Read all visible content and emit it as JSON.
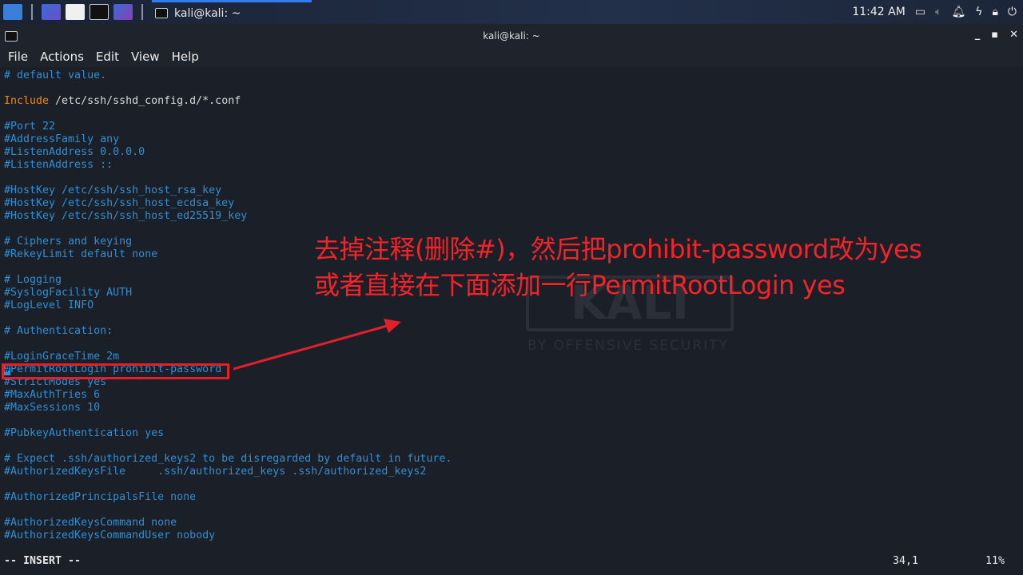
{
  "taskbar": {
    "task_title": "kali@kali: ~",
    "clock": "11:42 AM",
    "icons": [
      "kali-menu-icon",
      "desktop-icon",
      "file-manager-icon",
      "terminal-icon",
      "screen-recorder-icon"
    ],
    "tray": [
      "display-icon",
      "volume-icon",
      "notification-bell-icon",
      "battery-charging-icon",
      "lock-icon",
      "logout-icon"
    ]
  },
  "window": {
    "title": "kali@kali: ~"
  },
  "menu": [
    "File",
    "Actions",
    "Edit",
    "View",
    "Help"
  ],
  "lines": [
    "# default value.",
    "",
    "__INCLUDE__",
    "",
    "#Port 22",
    "#AddressFamily any",
    "#ListenAddress 0.0.0.0",
    "#ListenAddress ::",
    "",
    "#HostKey /etc/ssh/ssh_host_rsa_key",
    "#HostKey /etc/ssh/ssh_host_ecdsa_key",
    "#HostKey /etc/ssh/ssh_host_ed25519_key",
    "",
    "# Ciphers and keying",
    "#RekeyLimit default none",
    "",
    "# Logging",
    "#SyslogFacility AUTH",
    "#LogLevel INFO",
    "",
    "# Authentication:",
    "",
    "#LoginGraceTime 2m",
    "__CURSOR__",
    "#StrictModes yes",
    "#MaxAuthTries 6",
    "#MaxSessions 10",
    "",
    "#PubkeyAuthentication yes",
    "",
    "# Expect .ssh/authorized_keys2 to be disregarded by default in future.",
    "#AuthorizedKeysFile     .ssh/authorized_keys .ssh/authorized_keys2",
    "",
    "#AuthorizedPrincipalsFile none",
    "",
    "#AuthorizedKeysCommand none",
    "#AuthorizedKeysCommandUser nobody"
  ],
  "include_line": {
    "keyword": "Include",
    "path": " /etc/ssh/sshd_config.d/*.conf"
  },
  "cursor_line": {
    "cursor_char": "#",
    "rest": "PermitRootLogin prohibit-password"
  },
  "status": {
    "mode": "-- INSERT --",
    "position": "34,1",
    "percent": "11%"
  },
  "annotation": {
    "line1": "去掉注释(删除#)，然后把prohibit-password改为yes",
    "line2": "或者直接在下面添加一行PermitRootLogin yes",
    "color": "#f2242a"
  },
  "wallpaper": {
    "logo": "KALI",
    "tagline": "BY OFFENSIVE SECURITY"
  }
}
